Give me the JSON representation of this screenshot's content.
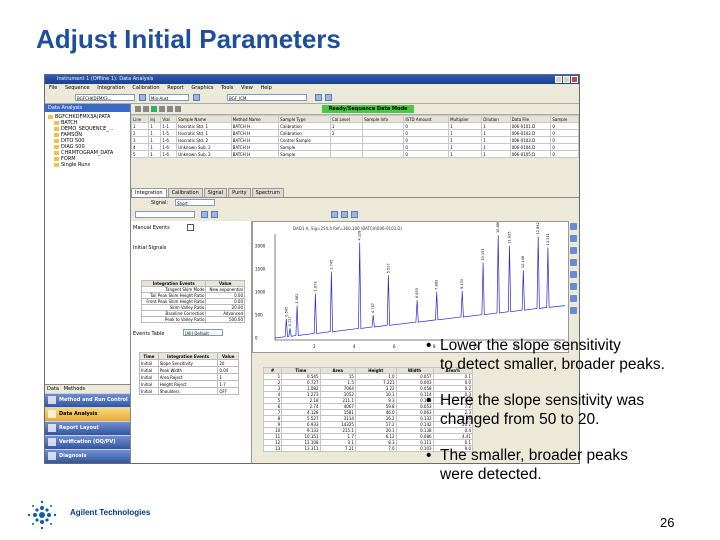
{
  "slide": {
    "title": "Adjust Initial Parameters",
    "bullets": [
      {
        "symbol": "•",
        "text": "Lower the slope sensitivity\n to detect smaller, broader peaks."
      },
      {
        "symbol": "•",
        "text": "Here the slope sensitivity was\n changed from 50 to 20."
      },
      {
        "symbol": "•",
        "text": "The smaller, broader peaks\n were detected."
      }
    ],
    "brand": "Agilent Technologies",
    "page_number": "26"
  },
  "app": {
    "window_title": "Instrument 1 (Offline 1): Data Analysis",
    "menu": [
      "File",
      "Sequence",
      "Integration",
      "Calibration",
      "Report",
      "Graphics",
      "Tools",
      "View",
      "Help"
    ],
    "toolbar": {
      "combo1": "BGFCHKDFMX3...",
      "combo2": "Min-Aust",
      "combo3": "BGF_ICM"
    },
    "status_banner": "Ready/Sequence Data Mode",
    "nav": {
      "header": "Data Analysis",
      "tree": [
        "BGFCHKDFMX3A(PATA",
        "BATCH",
        "DEMO_SEQUENCE_...",
        "FAMSON",
        "DITO S00",
        "DIAG S00",
        "CHRMTOGRAM_DATA",
        "FORM",
        "Single Runs"
      ],
      "tabs": [
        "Data",
        "Methods"
      ],
      "buttons": [
        "Method and Run Control",
        "Data Analysis",
        "Report Layout",
        "Verification (OQ/PV)",
        "Diagnosis"
      ],
      "selected_button": "Data Analysis"
    },
    "sequence_table": {
      "columns": [
        "Line",
        "Inj",
        "Vial",
        "Sample Name",
        "Method Name",
        "Sample Type",
        "Cal Level",
        "Sample Info",
        "ISTD Amount",
        "Multiplier",
        "Dilution",
        "Data File",
        "Sample"
      ],
      "rows": [
        [
          "1",
          "1",
          "1-1",
          "Isocratic Std. 1",
          "BATCH H",
          "Calibration",
          "1",
          "",
          "0",
          "1",
          "1",
          "006-0101.D",
          "0"
        ],
        [
          "2",
          "1",
          "1-5",
          "Isocratic Std. 1",
          "BATCH H",
          "Calibration",
          "2",
          "",
          "0",
          "1",
          "1",
          "006-0102.D",
          "0"
        ],
        [
          "3",
          "1",
          "1-6",
          "Isocratic Std. 2",
          "BATCH H",
          "Control Sample",
          "",
          "",
          "0",
          "1",
          "1",
          "006-0103.D",
          "0"
        ],
        [
          "4",
          "1",
          "1-6",
          "Unknown Sub. 2",
          "BATCH H",
          "Sample",
          "",
          "",
          "0",
          "1",
          "1",
          "006-0104.D",
          "0"
        ],
        [
          "5",
          "1",
          "1-6",
          "Unknown Sub. 2",
          "BATCH H",
          "Sample",
          "",
          "",
          "0",
          "1",
          "1",
          "006-0105.D",
          "0"
        ]
      ]
    },
    "view_tabs": [
      "Integration",
      "Calibration",
      "Signal",
      "Purity",
      "Spectrum"
    ],
    "selected_view_tab": "Integration",
    "panel": {
      "signal_label": "Signal:",
      "signal_value": "Short",
      "manual_events_label": "Manual Events",
      "initial_signals_label": "Initial Signals",
      "events_table_label": "Events Table",
      "events_table_value": "[All] Default"
    },
    "integration_events": {
      "headers": [
        "Integration Events",
        "Value"
      ],
      "rows": [
        [
          "Tangent Skim Mode",
          "New exponential"
        ],
        [
          "Tail Peak Skim Height Ratio",
          "0.00"
        ],
        [
          "Front Peak Skim Height Ratio",
          "0.00"
        ],
        [
          "Skim Valley Ratio",
          "20.00"
        ],
        [
          "Baseline Correction",
          "Advanced"
        ],
        [
          "Peak to Valley Ratio",
          "500.00"
        ]
      ]
    },
    "timed_events": {
      "headers": [
        "Time",
        "Integration Events",
        "Value"
      ],
      "rows": [
        [
          "Initial",
          "Slope Sensitivity",
          "20"
        ],
        [
          "Initial",
          "Peak Width",
          "0.04"
        ],
        [
          "Initial",
          "Area Reject",
          "1"
        ],
        [
          "Initial",
          "Height Reject",
          "1.7"
        ],
        [
          "Initial",
          "Shoulders",
          "OFF"
        ]
      ]
    },
    "chromatogram": {
      "title": "DAD1 A, Sig=254,4 Ref=360,100 (BATCH\\006-0103.D)",
      "y_ticks": [
        "2000",
        "1500",
        "1000",
        "500",
        "0"
      ],
      "x_ticks": [
        "2",
        "4",
        "6",
        "8",
        "10",
        "12",
        "14"
      ],
      "peak_labels": [
        "0.545",
        "0.727",
        "1.082",
        "1.973",
        "2.745",
        "4.128",
        "4.787",
        "5.527",
        "6.933",
        "7.893",
        "9.133",
        "10.151",
        "10.889",
        "11.435",
        "12.108",
        "12.842",
        "13.311"
      ]
    },
    "peak_table": {
      "headers": [
        "#",
        "Time",
        "Area",
        "Height",
        "Width",
        "Area%"
      ],
      "rows": [
        [
          "1",
          "0.545",
          "15",
          "1.0",
          "0.057",
          "0.1"
        ],
        [
          "2",
          "0.727",
          "1.5",
          "7.221",
          "0.003",
          "0.0"
        ],
        [
          "3",
          "1.082",
          "7064",
          "3.22",
          "0.058",
          "0.2"
        ],
        [
          "4",
          "1.273",
          "1052",
          "10.1",
          "0.114",
          "0.3"
        ],
        [
          "5",
          "2.18",
          "211.1",
          "9.3",
          "0.125",
          "0.6"
        ],
        [
          "6",
          "2.74",
          "4067",
          "59.8",
          "0.053",
          "7.2"
        ],
        [
          "7",
          "4.128",
          "1581",
          "46.0",
          "0.063",
          "2.3"
        ],
        [
          "8",
          "5.527",
          "3114",
          "16.2",
          "0.132",
          "2.06"
        ],
        [
          "9",
          "6.933",
          "14325",
          "17.2",
          "0.142",
          "20.2"
        ],
        [
          "10",
          "9.133",
          "215.1",
          "20.1",
          "0.138",
          "0.4"
        ],
        [
          "11",
          "10.151",
          "1.7",
          "6.12",
          "0.086",
          "4.41"
        ],
        [
          "12",
          "12.108",
          "3.1",
          "8.3",
          "0.111",
          "0.1"
        ],
        [
          "13",
          "13.311",
          "7.21",
          "7.0",
          "0.103",
          "9.0"
        ]
      ]
    }
  }
}
